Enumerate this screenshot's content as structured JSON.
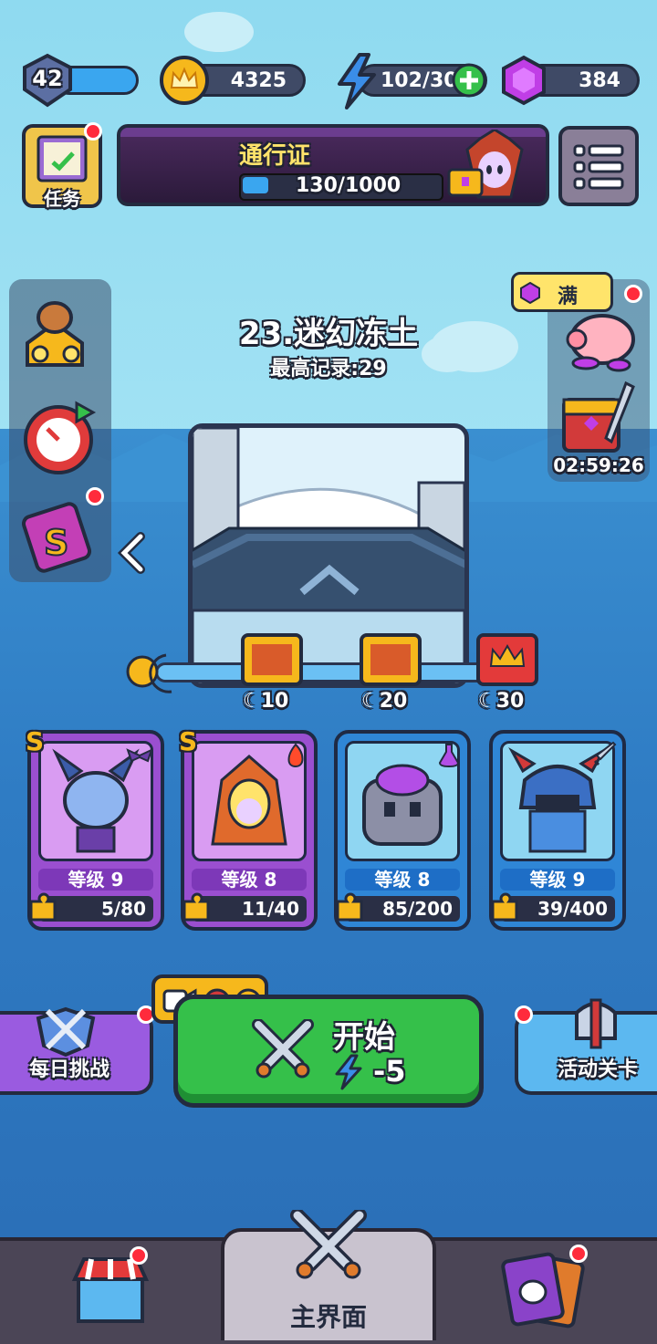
{
  "colors": {
    "accent_green": "#35c04a",
    "accent_purple": "#8a43c9",
    "accent_blue": "#2f86d6",
    "red_dot": "#ff2b3c"
  },
  "top_bar": {
    "level": "42",
    "coins": "4325",
    "energy": "102/30",
    "gems": "384"
  },
  "tasks": {
    "label": "任务"
  },
  "pass": {
    "title": "通行证",
    "progress": "130/1000",
    "progress_fraction": 0.13
  },
  "stage": {
    "name": "23.迷幻冻土",
    "record": "最高记录:29"
  },
  "piggy": {
    "label": "满"
  },
  "chest": {
    "timer": "02:59:26"
  },
  "milestones": [
    {
      "value": "10",
      "icon": "treasure-chest"
    },
    {
      "value": "20",
      "icon": "treasure-chest"
    },
    {
      "value": "30",
      "icon": "crown-chest"
    }
  ],
  "heroes": [
    {
      "level_text": "等级 9",
      "progress": "5/80",
      "rarity": "S",
      "element_icon": "bat-icon",
      "theme": "purple"
    },
    {
      "level_text": "等级 8",
      "progress": "11/40",
      "rarity": "S",
      "element_icon": "fire-icon",
      "theme": "purple"
    },
    {
      "level_text": "等级 8",
      "progress": "85/200",
      "rarity": "",
      "element_icon": "potion-icon",
      "theme": "blue"
    },
    {
      "level_text": "等级 9",
      "progress": "39/400",
      "rarity": "",
      "element_icon": "sword-icon",
      "theme": "blue"
    }
  ],
  "actions": {
    "daily": "每日挑战",
    "start": "开始",
    "start_cost": "-5",
    "event": "活动关卡"
  },
  "nav": {
    "home": "主界面"
  }
}
